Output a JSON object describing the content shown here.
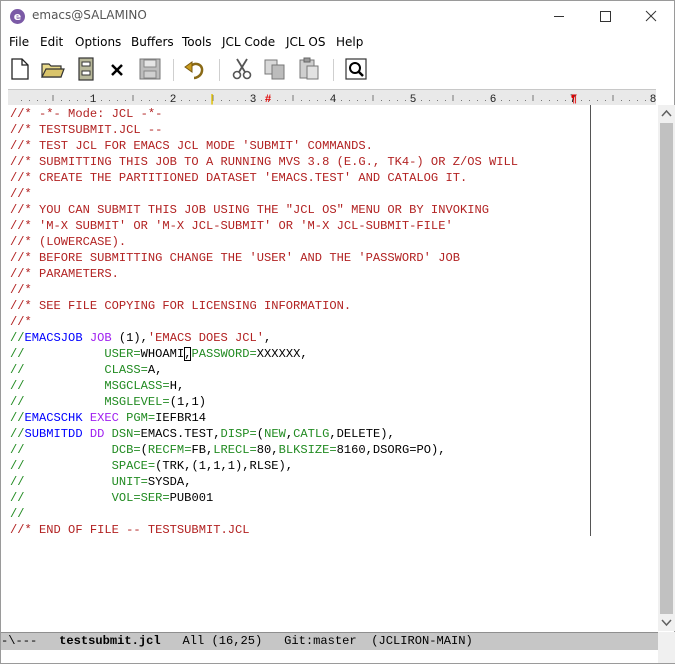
{
  "window": {
    "title": "emacs@SALAMINO"
  },
  "menu": [
    "File",
    "Edit",
    "Options",
    "Buffers",
    "Tools",
    "JCL Code",
    "JCL OS",
    "Help"
  ],
  "toolbar": {
    "icons": [
      "new-file-icon",
      "open-folder-icon",
      "dired-icon",
      "close-buffer-icon",
      "save-icon",
      "undo-icon",
      "cut-icon",
      "copy-icon",
      "paste-icon",
      "search-icon"
    ]
  },
  "ruler": {
    "numbers": [
      "1",
      "2",
      "3",
      "4",
      "5",
      "6",
      "7",
      "8"
    ]
  },
  "buffer": {
    "lines": [
      [
        {
          "t": "//* -*- Mode: JCL -*-",
          "s": "c"
        }
      ],
      [
        {
          "t": "//* TESTSUBMIT.JCL --",
          "s": "c"
        }
      ],
      [
        {
          "t": "//* TEST JCL FOR EMACS JCL MODE 'SUBMIT' COMMANDS.",
          "s": "c"
        }
      ],
      [
        {
          "t": "//* SUBMITTING THIS JOB TO A RUNNING MVS 3.8 (E.G., TK4-) OR Z/OS WILL",
          "s": "c"
        }
      ],
      [
        {
          "t": "//* CREATE THE PARTITIONED DATASET 'EMACS.TEST' AND CATALOG IT.",
          "s": "c"
        }
      ],
      [
        {
          "t": "//*",
          "s": "c"
        }
      ],
      [
        {
          "t": "//* YOU CAN SUBMIT THIS JOB USING THE \"JCL OS\" MENU OR BY INVOKING",
          "s": "c"
        }
      ],
      [
        {
          "t": "//* 'M-X SUBMIT' OR 'M-X JCL-SUBMIT' OR 'M-X JCL-SUBMIT-FILE'",
          "s": "c"
        }
      ],
      [
        {
          "t": "//* (LOWERCASE).",
          "s": "c"
        }
      ],
      [
        {
          "t": "//* BEFORE SUBMITTING CHANGE THE 'USER' AND THE 'PASSWORD' JOB",
          "s": "c"
        }
      ],
      [
        {
          "t": "//* PARAMETERS.",
          "s": "c"
        }
      ],
      [
        {
          "t": "//*",
          "s": "c"
        }
      ],
      [
        {
          "t": "//* SEE FILE COPYING FOR LICENSING INFORMATION.",
          "s": "c"
        }
      ],
      [
        {
          "t": "//*",
          "s": "c"
        }
      ],
      [
        {
          "t": "//",
          "s": "g"
        },
        {
          "t": "EMACSJOB",
          "s": "b"
        },
        {
          "t": " ",
          "s": "p"
        },
        {
          "t": "JOB",
          "s": "k"
        },
        {
          "t": " (1),",
          "s": "p"
        },
        {
          "t": "'EMACS DOES JCL'",
          "s": "c"
        },
        {
          "t": ",",
          "s": "p"
        }
      ],
      [
        {
          "t": "//           ",
          "s": "g"
        },
        {
          "t": "USER=",
          "s": "g"
        },
        {
          "t": "WHOAMI",
          "s": "p"
        },
        {
          "t": ",",
          "s": "cur"
        },
        {
          "t": "PASSWORD=",
          "s": "g"
        },
        {
          "t": "XXXXXX,",
          "s": "p"
        }
      ],
      [
        {
          "t": "//           ",
          "s": "g"
        },
        {
          "t": "CLASS=",
          "s": "g"
        },
        {
          "t": "A,",
          "s": "p"
        }
      ],
      [
        {
          "t": "//           ",
          "s": "g"
        },
        {
          "t": "MSGCLASS=",
          "s": "g"
        },
        {
          "t": "H,",
          "s": "p"
        }
      ],
      [
        {
          "t": "//           ",
          "s": "g"
        },
        {
          "t": "MSGLEVEL=",
          "s": "g"
        },
        {
          "t": "(1,1)",
          "s": "p"
        }
      ],
      [
        {
          "t": "//",
          "s": "g"
        },
        {
          "t": "EMACSCHK",
          "s": "b"
        },
        {
          "t": " ",
          "s": "p"
        },
        {
          "t": "EXEC",
          "s": "k"
        },
        {
          "t": " ",
          "s": "p"
        },
        {
          "t": "PGM=",
          "s": "g"
        },
        {
          "t": "IEFBR14",
          "s": "p"
        }
      ],
      [
        {
          "t": "//",
          "s": "g"
        },
        {
          "t": "SUBMITDD",
          "s": "b"
        },
        {
          "t": " ",
          "s": "p"
        },
        {
          "t": "DD",
          "s": "k"
        },
        {
          "t": " ",
          "s": "p"
        },
        {
          "t": "DSN=",
          "s": "g"
        },
        {
          "t": "EMACS.TEST,",
          "s": "p"
        },
        {
          "t": "DISP=",
          "s": "g"
        },
        {
          "t": "(",
          "s": "p"
        },
        {
          "t": "NEW",
          "s": "g"
        },
        {
          "t": ",",
          "s": "p"
        },
        {
          "t": "CATLG",
          "s": "g"
        },
        {
          "t": ",DELETE),",
          "s": "p"
        }
      ],
      [
        {
          "t": "//            ",
          "s": "g"
        },
        {
          "t": "DCB=",
          "s": "g"
        },
        {
          "t": "(",
          "s": "p"
        },
        {
          "t": "RECFM=",
          "s": "g"
        },
        {
          "t": "FB,",
          "s": "p"
        },
        {
          "t": "LRECL=",
          "s": "g"
        },
        {
          "t": "80,",
          "s": "p"
        },
        {
          "t": "BLKSIZE=",
          "s": "g"
        },
        {
          "t": "8160,DSORG=PO),",
          "s": "p"
        }
      ],
      [
        {
          "t": "//            ",
          "s": "g"
        },
        {
          "t": "SPACE=",
          "s": "g"
        },
        {
          "t": "(TRK,(1,1,1),RLSE),",
          "s": "p"
        }
      ],
      [
        {
          "t": "//            ",
          "s": "g"
        },
        {
          "t": "UNIT=",
          "s": "g"
        },
        {
          "t": "SYSDA,",
          "s": "p"
        }
      ],
      [
        {
          "t": "//            ",
          "s": "g"
        },
        {
          "t": "VOL=SER=",
          "s": "g"
        },
        {
          "t": "PUB001",
          "s": "p"
        }
      ],
      [
        {
          "t": "//",
          "s": "g"
        }
      ],
      [
        {
          "t": "//* END OF FILE -- TESTSUBMIT.JCL",
          "s": "c"
        }
      ]
    ]
  },
  "modeline": {
    "flags": "-\\---",
    "buffer_name": "testsubmit.jcl",
    "position": "All (16,25)",
    "vc": "Git:master",
    "mode": "(JCLIRON-MAIN)"
  }
}
